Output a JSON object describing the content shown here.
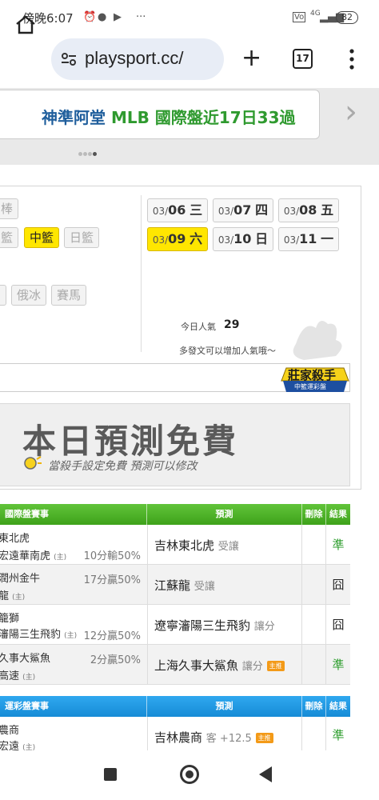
{
  "status": {
    "time": "傍晚6:07",
    "battery": "82",
    "net": "4G"
  },
  "browser": {
    "url": "playsport.cc/",
    "tab_count": "17"
  },
  "banner": {
    "part1": "神準阿堂 ",
    "part2": "MLB 國際盤近17日33過"
  },
  "sports": {
    "row1": [
      "棒"
    ],
    "row2": [
      "籃",
      "中籃",
      "日籃"
    ],
    "row3": [
      "",
      "俄冰",
      "賽馬"
    ]
  },
  "dates": [
    {
      "md": "03/",
      "day": "06",
      "wd": "三"
    },
    {
      "md": "03/",
      "day": "07",
      "wd": "四"
    },
    {
      "md": "03/",
      "day": "08",
      "wd": "五"
    },
    {
      "md": "03/",
      "day": "09",
      "wd": "六"
    },
    {
      "md": "03/",
      "day": "10",
      "wd": "日"
    },
    {
      "md": "03/",
      "day": "11",
      "wd": "一"
    }
  ],
  "popularity": {
    "label": "今日人氣",
    "value": "29",
    "hint": "多發文可以增加人氣哦～"
  },
  "killer_badge": {
    "title": "莊家殺手",
    "sub": "中籃運彩盤"
  },
  "free_banner": {
    "title": "本日預測免費",
    "subtitle": "當殺手設定免費  預測可以修改"
  },
  "intl_table": {
    "headers": [
      "國際盤賽事",
      "預測",
      "刪除",
      "結果"
    ],
    "rows": [
      {
        "team1": "東北虎",
        "team2": "宏遠華南虎",
        "team2_tag": "(主)",
        "odds": "10分輸50%",
        "pick": "吉林東北虎",
        "pick_tag": "受讓",
        "master": "",
        "result": "準"
      },
      {
        "team1": "潤州金牛",
        "team2": "龍",
        "team2_tag": "(主)",
        "odds": "17分贏50%",
        "pick": "江蘇龍",
        "pick_tag": "受讓",
        "master": "",
        "result": "囧"
      },
      {
        "team1": "籠獅",
        "team2": "瀋陽三生飛豹",
        "team2_tag": "(主)",
        "odds": "12分贏50%",
        "pick": "遼寧瀋陽三生飛豹",
        "pick_tag": "讓分",
        "master": "",
        "result": "囧"
      },
      {
        "team1": "久事大鯊魚",
        "team2": "高速",
        "team2_tag": "(主)",
        "odds": "2分贏50%",
        "pick": "上海久事大鯊魚",
        "pick_tag": "讓分",
        "master": "主推",
        "result": "準"
      }
    ]
  },
  "lottery_table": {
    "headers": [
      "運彩盤賽事",
      "預測",
      "刪除",
      "結果"
    ],
    "rows": [
      {
        "team1": "農商",
        "team2": "宏遠",
        "team2_tag": "(主)",
        "pick": "吉林農商",
        "pick_tag": "客 +12.5",
        "master": "主推",
        "result": "準"
      }
    ]
  }
}
